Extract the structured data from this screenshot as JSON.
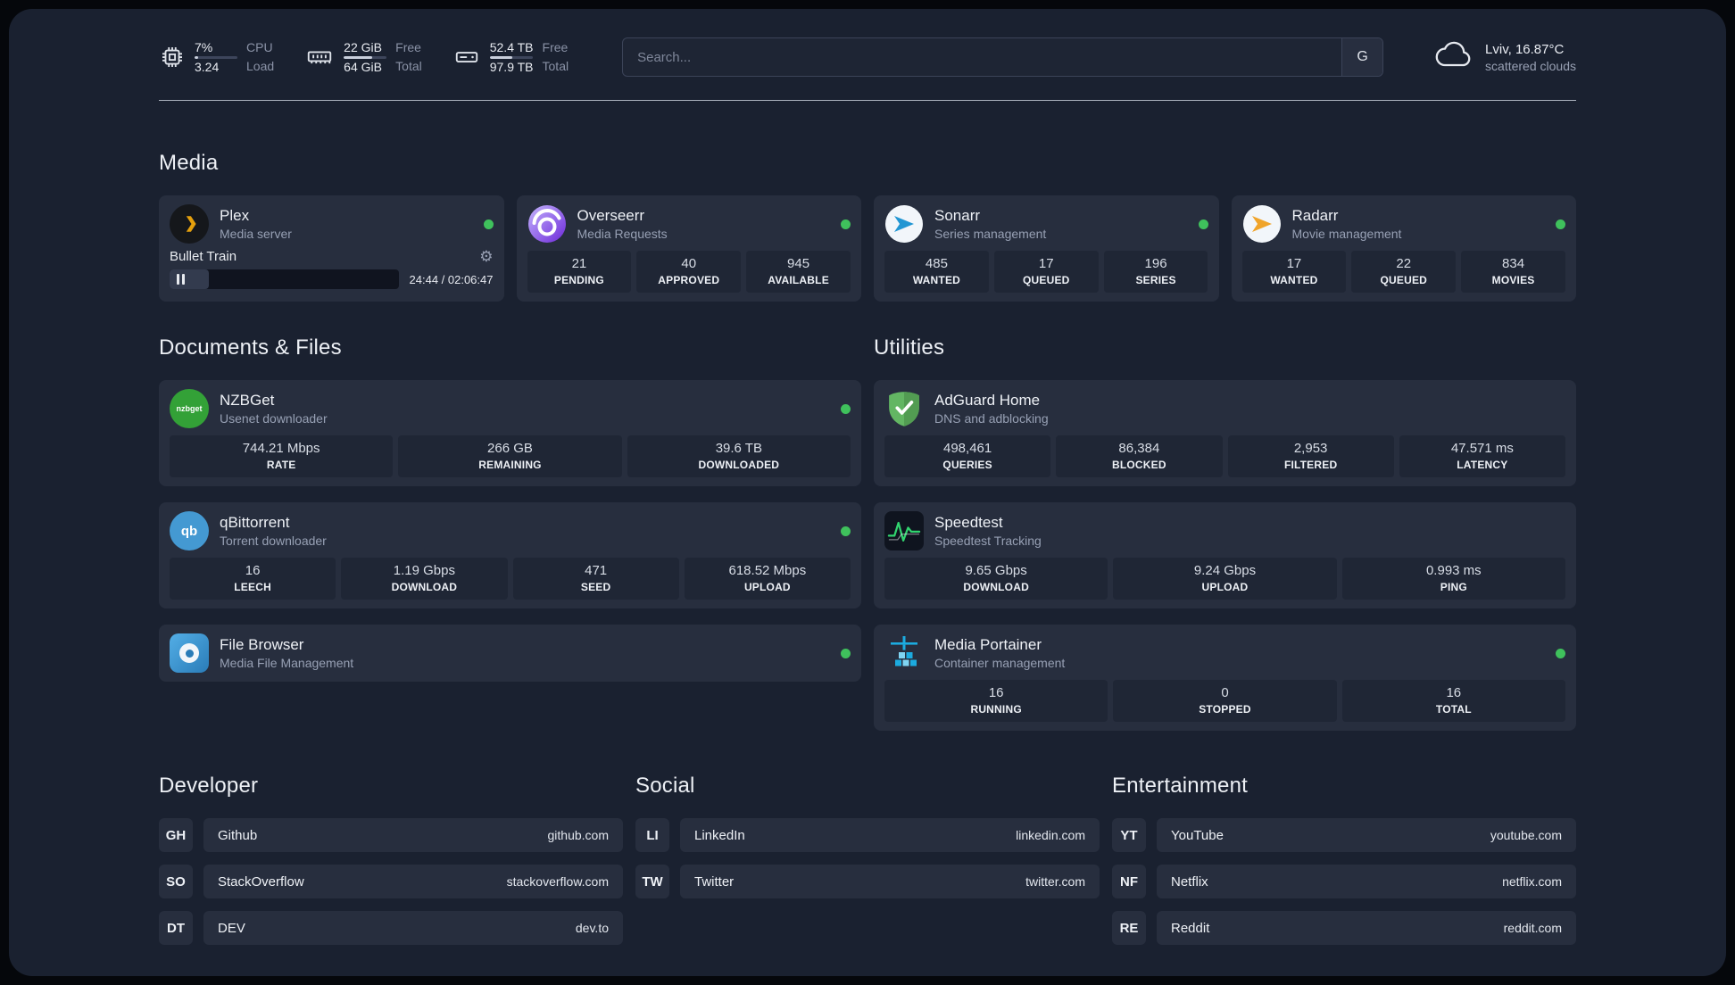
{
  "header": {
    "metrics": [
      {
        "id": "cpu",
        "value_top": "7%",
        "value_bottom": "3.24",
        "label_top": "CPU",
        "label_bottom": "Load"
      },
      {
        "id": "memory",
        "value_top": "22 GiB",
        "value_bottom": "64 GiB",
        "label_top": "Free",
        "label_bottom": "Total"
      },
      {
        "id": "storage",
        "value_top": "52.4 TB",
        "value_bottom": "97.9 TB",
        "label_top": "Free",
        "label_bottom": "Total"
      }
    ],
    "search": {
      "placeholder": "Search...",
      "engine_label": "G"
    },
    "weather": {
      "location": "Lviv, 16.87°C",
      "condition": "scattered clouds"
    }
  },
  "sections": {
    "media": {
      "title": "Media",
      "plex": {
        "name": "Plex",
        "subtitle": "Media server",
        "status": "online",
        "now_playing": "Bullet Train",
        "time": "24:44 / 02:06:47"
      },
      "overseerr": {
        "name": "Overseerr",
        "subtitle": "Media Requests",
        "status": "online",
        "stats": [
          {
            "value": "21",
            "label": "PENDING"
          },
          {
            "value": "40",
            "label": "APPROVED"
          },
          {
            "value": "945",
            "label": "AVAILABLE"
          }
        ]
      },
      "sonarr": {
        "name": "Sonarr",
        "subtitle": "Series management",
        "status": "online",
        "stats": [
          {
            "value": "485",
            "label": "WANTED"
          },
          {
            "value": "17",
            "label": "QUEUED"
          },
          {
            "value": "196",
            "label": "SERIES"
          }
        ]
      },
      "radarr": {
        "name": "Radarr",
        "subtitle": "Movie management",
        "status": "online",
        "stats": [
          {
            "value": "17",
            "label": "WANTED"
          },
          {
            "value": "22",
            "label": "QUEUED"
          },
          {
            "value": "834",
            "label": "MOVIES"
          }
        ]
      }
    },
    "documents_files": {
      "title": "Documents & Files",
      "nzbget": {
        "name": "NZBGet",
        "subtitle": "Usenet downloader",
        "icon_text": "nzbget",
        "status": "online",
        "stats": [
          {
            "value": "744.21 Mbps",
            "label": "RATE"
          },
          {
            "value": "266 GB",
            "label": "REMAINING"
          },
          {
            "value": "39.6 TB",
            "label": "DOWNLOADED"
          }
        ]
      },
      "qbittorrent": {
        "name": "qBittorrent",
        "subtitle": "Torrent downloader",
        "icon_text": "qb",
        "status": "online",
        "stats": [
          {
            "value": "16",
            "label": "LEECH"
          },
          {
            "value": "1.19 Gbps",
            "label": "DOWNLOAD"
          },
          {
            "value": "471",
            "label": "SEED"
          },
          {
            "value": "618.52 Mbps",
            "label": "UPLOAD"
          }
        ]
      },
      "filebrowser": {
        "name": "File Browser",
        "subtitle": "Media File Management",
        "status": "online"
      }
    },
    "utilities": {
      "title": "Utilities",
      "adguard": {
        "name": "AdGuard Home",
        "subtitle": "DNS and adblocking",
        "stats": [
          {
            "value": "498,461",
            "label": "QUERIES"
          },
          {
            "value": "86,384",
            "label": "BLOCKED"
          },
          {
            "value": "2,953",
            "label": "FILTERED"
          },
          {
            "value": "47.571 ms",
            "label": "LATENCY"
          }
        ]
      },
      "speedtest": {
        "name": "Speedtest",
        "subtitle": "Speedtest Tracking",
        "stats": [
          {
            "value": "9.65 Gbps",
            "label": "DOWNLOAD"
          },
          {
            "value": "9.24 Gbps",
            "label": "UPLOAD"
          },
          {
            "value": "0.993 ms",
            "label": "PING"
          }
        ]
      },
      "portainer": {
        "name": "Media Portainer",
        "subtitle": "Container management",
        "status": "online",
        "stats": [
          {
            "value": "16",
            "label": "RUNNING"
          },
          {
            "value": "0",
            "label": "STOPPED"
          },
          {
            "value": "16",
            "label": "TOTAL"
          }
        ]
      }
    },
    "developer": {
      "title": "Developer",
      "links": [
        {
          "abbr": "GH",
          "name": "Github",
          "url": "github.com"
        },
        {
          "abbr": "SO",
          "name": "StackOverflow",
          "url": "stackoverflow.com"
        },
        {
          "abbr": "DT",
          "name": "DEV",
          "url": "dev.to"
        }
      ]
    },
    "social": {
      "title": "Social",
      "links": [
        {
          "abbr": "LI",
          "name": "LinkedIn",
          "url": "linkedin.com"
        },
        {
          "abbr": "TW",
          "name": "Twitter",
          "url": "twitter.com"
        }
      ]
    },
    "entertainment": {
      "title": "Entertainment",
      "links": [
        {
          "abbr": "YT",
          "name": "YouTube",
          "url": "youtube.com"
        },
        {
          "abbr": "NF",
          "name": "Netflix",
          "url": "netflix.com"
        },
        {
          "abbr": "RE",
          "name": "Reddit",
          "url": "reddit.com"
        }
      ]
    }
  }
}
